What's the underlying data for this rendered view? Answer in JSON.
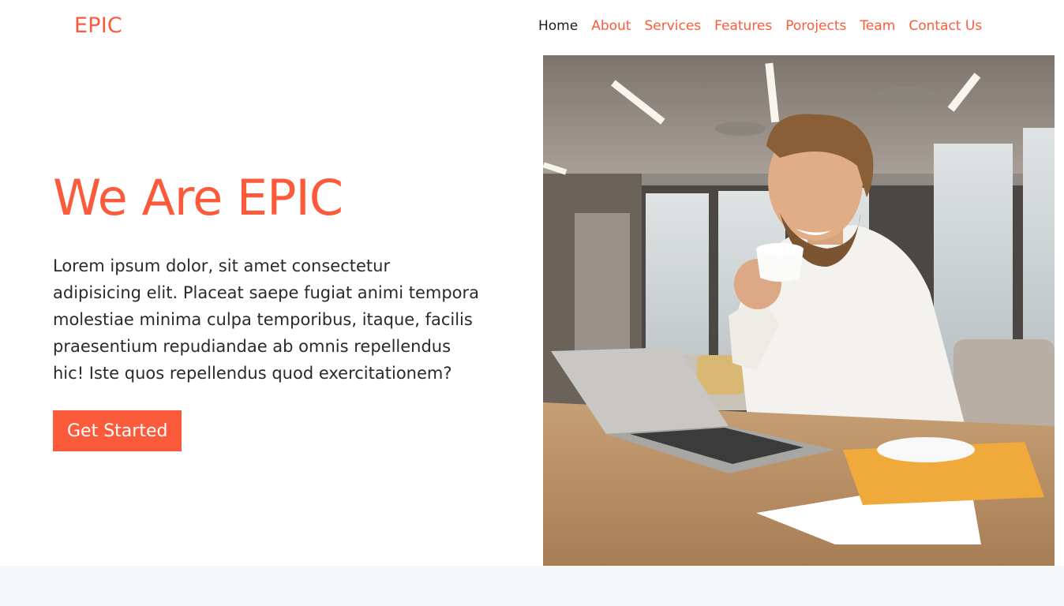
{
  "navbar": {
    "brand": "EPIC",
    "links": [
      {
        "label": "Home",
        "active": true
      },
      {
        "label": "About",
        "active": false
      },
      {
        "label": "Services",
        "active": false
      },
      {
        "label": "Features",
        "active": false
      },
      {
        "label": "Porojects",
        "active": false
      },
      {
        "label": "Team",
        "active": false
      },
      {
        "label": "Contact Us",
        "active": false
      }
    ]
  },
  "hero": {
    "title": "We Are EPIC",
    "paragraph": "Lorem ipsum dolor, sit amet consectetur adipisicing elit. Placeat saepe fugiat animi tempora molestiae minima culpa temporibus, itaque, facilis praesentium repudiandae ab omnis repellendus hic! Iste quos repellendus quod exercitationem?",
    "cta_label": "Get Started",
    "image_icon": "office-man-laptop-photo"
  },
  "colors": {
    "accent": "#fb5b3b",
    "text": "#2a2a2a",
    "band": "#f6f7f9"
  }
}
